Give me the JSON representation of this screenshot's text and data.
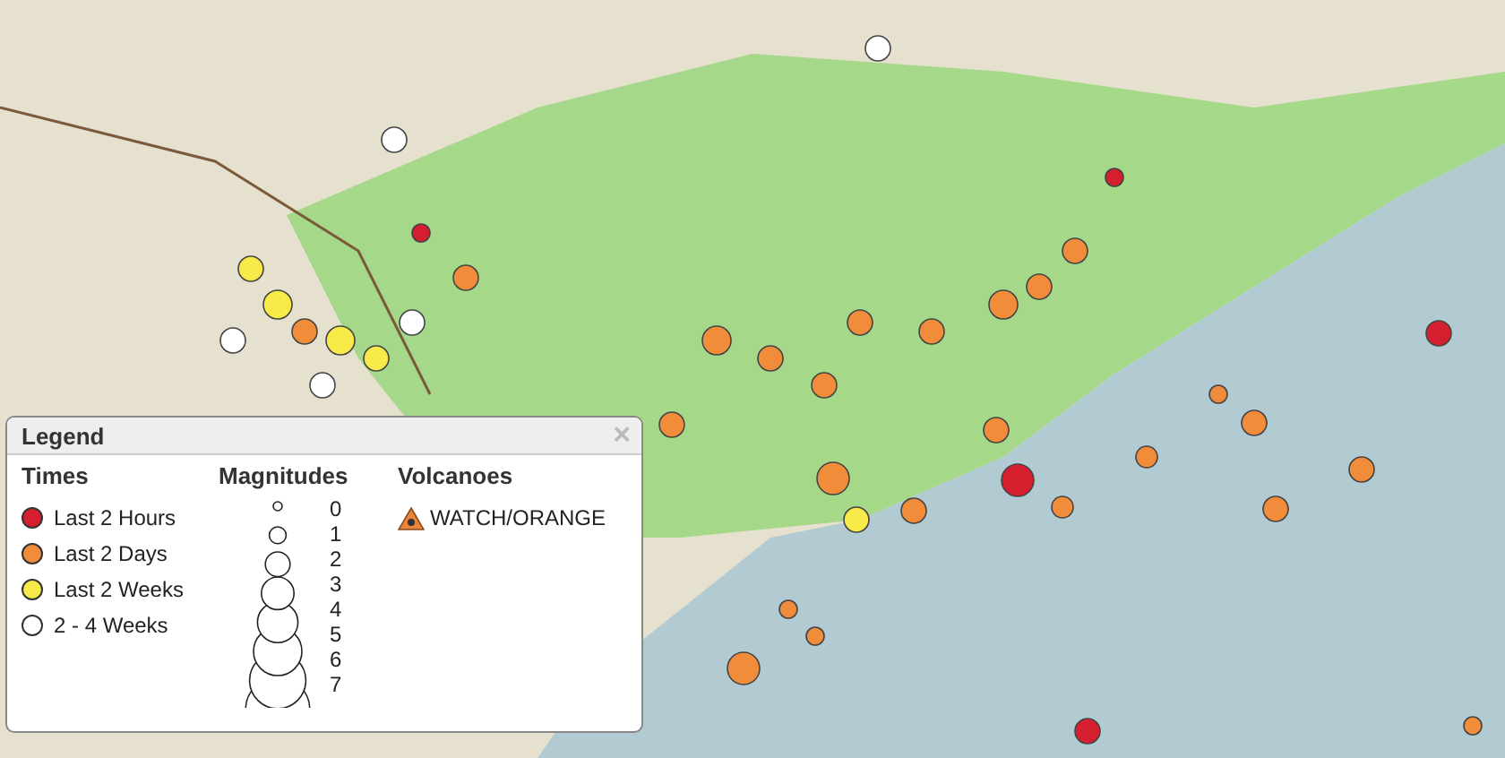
{
  "legend": {
    "title": "Legend",
    "close": "×",
    "times": {
      "heading": "Times",
      "items": [
        {
          "label": "Last 2 Hours",
          "color": "#d51f2e"
        },
        {
          "label": "Last 2 Days",
          "color": "#f18d3a"
        },
        {
          "label": "Last 2 Weeks",
          "color": "#f8ea48"
        },
        {
          "label": "2 - 4 Weeks",
          "color": "#ffffff"
        }
      ]
    },
    "magnitudes": {
      "heading": "Magnitudes",
      "values": [
        "0",
        "1",
        "2",
        "3",
        "4",
        "5",
        "6",
        "7"
      ]
    },
    "volcanoes": {
      "heading": "Volcanoes",
      "items": [
        {
          "label": "WATCH/ORANGE"
        }
      ]
    }
  }
}
